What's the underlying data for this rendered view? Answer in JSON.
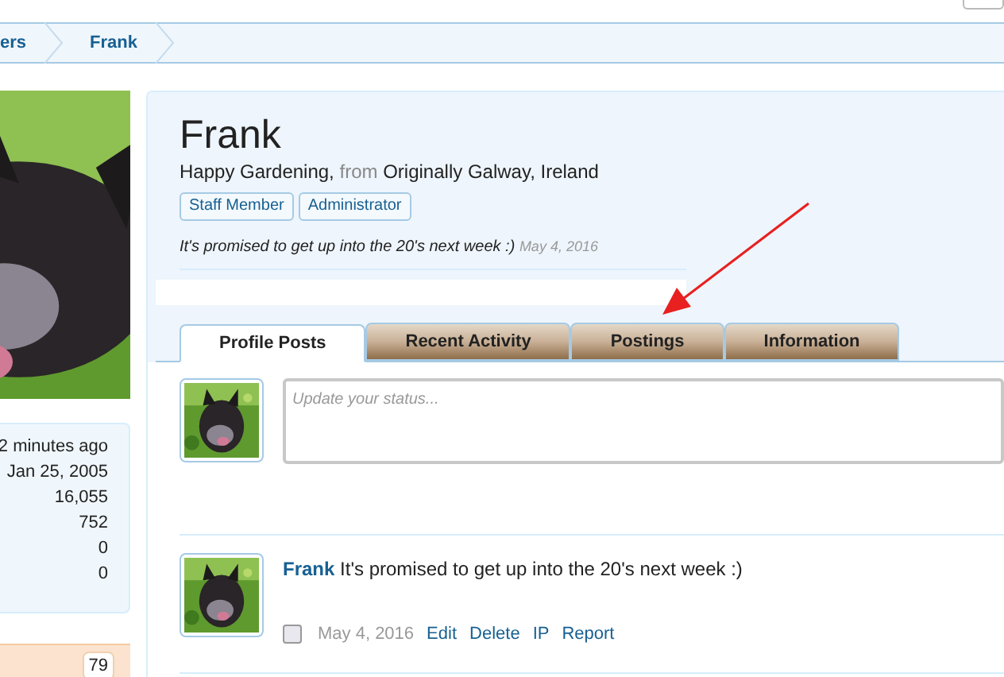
{
  "breadcrumbs": [
    {
      "label": "ers"
    },
    {
      "label": "Frank"
    }
  ],
  "profile": {
    "name": "Frank",
    "tagline": "Happy Gardening,",
    "from_word": "from",
    "location": "Originally Galway, Ireland",
    "badges": [
      "Staff Member",
      "Administrator"
    ],
    "status": "It's promised to get up into the 20's next week :)",
    "status_date": "May 4, 2016"
  },
  "tabs": [
    {
      "label": "Profile Posts",
      "selected": true
    },
    {
      "label": "Recent Activity",
      "selected": false
    },
    {
      "label": "Postings",
      "selected": false
    },
    {
      "label": "Information",
      "selected": false
    }
  ],
  "status_field": {
    "placeholder": "Update your status..."
  },
  "stats": [
    "2 minutes ago",
    "Jan 25, 2005",
    "16,055",
    "752",
    "0",
    "0"
  ],
  "sidebar_count": "79",
  "post": {
    "author": "Frank",
    "text": "It's promised to get up into the 20's next week :)",
    "checked": false,
    "date": "May 4, 2016",
    "actions": [
      "Edit",
      "Delete",
      "IP",
      "Report"
    ]
  }
}
